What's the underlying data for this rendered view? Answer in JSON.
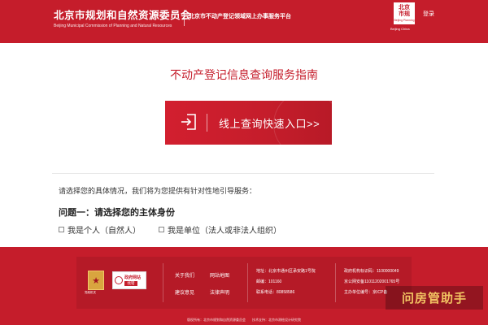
{
  "header": {
    "org_cn": "北京市规划和自然资源委员会",
    "org_en": "Beijing Municipal Commission of Planning and Natural Resources",
    "platform": "北京市不动产登记领域网上办事服务平台",
    "logo_chars": [
      "北",
      "京",
      "市",
      "规"
    ],
    "logo_sub": "Beijing Planning",
    "logo_caption": "Beijing China",
    "login": "登录"
  },
  "main": {
    "title": "不动产登记信息查询服务指南",
    "cta_label": "线上查询快速入口>>",
    "intro": "请选择您的具体情况，我们将为您提供有针对性地引导服务：",
    "question": "问题一：请选择您的主体身份",
    "options": [
      "我是个人（自然人）",
      "我是单位（法人或非法人组织）"
    ]
  },
  "footer": {
    "emblem_label": "党政机关",
    "gov_badge": {
      "title": "政府网站",
      "tag": "找错"
    },
    "links": [
      "关于我们",
      "网站地图",
      "建议意见",
      "法律声明"
    ],
    "contact": {
      "address": "地址：北京市通州区承安路1号院",
      "postcode": "邮编：101160",
      "phone": "联系电话：80858586"
    },
    "records": {
      "gov_id": "政府机构标识码：1100000049",
      "police": "京公网安备11011202001765号",
      "icp": "主办单位编号：京ICP备"
    },
    "copyright": "版权所有：北京市规划和自然资源委员会　　技术支持：北京市测绘设计研究院"
  },
  "watermark": "问房管助手",
  "colors": {
    "brand_red": "#c51d2b",
    "gold": "#d9a53f"
  }
}
